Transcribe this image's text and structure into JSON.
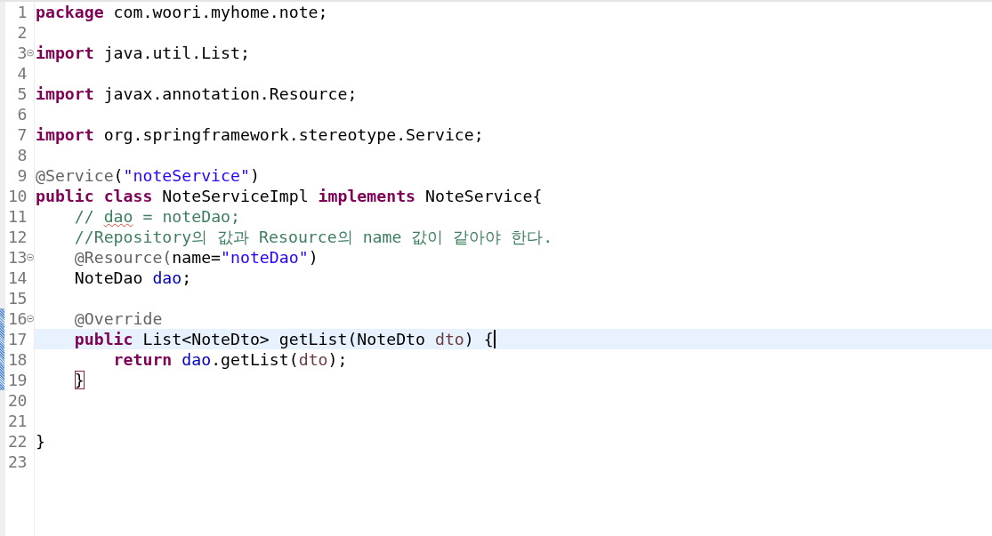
{
  "editor": {
    "lines": [
      {
        "number": "1",
        "current": false,
        "changed": false,
        "fold_marker": false,
        "caret": false,
        "tokens": [
          {
            "kind": "keyword",
            "text": "package"
          },
          {
            "kind": "plain",
            "text": " com.woori.myhome.note;"
          }
        ]
      },
      {
        "number": "2",
        "current": false,
        "changed": false,
        "fold_marker": false,
        "caret": false
      },
      {
        "number": "3",
        "current": false,
        "changed": false,
        "fold_marker": true,
        "caret": false,
        "tokens": [
          {
            "kind": "keyword",
            "text": "import"
          },
          {
            "kind": "plain",
            "text": " java.util.List;"
          }
        ]
      },
      {
        "number": "4",
        "current": false,
        "changed": false,
        "fold_marker": false,
        "caret": false
      },
      {
        "number": "5",
        "current": false,
        "changed": false,
        "fold_marker": false,
        "caret": false,
        "tokens": [
          {
            "kind": "keyword",
            "text": "import"
          },
          {
            "kind": "plain",
            "text": " javax.annotation.Resource;"
          }
        ]
      },
      {
        "number": "6",
        "current": false,
        "changed": false,
        "fold_marker": false,
        "caret": false
      },
      {
        "number": "7",
        "current": false,
        "changed": false,
        "fold_marker": false,
        "caret": false,
        "tokens": [
          {
            "kind": "keyword",
            "text": "import"
          },
          {
            "kind": "plain",
            "text": " org.springframework.stereotype.Service;"
          }
        ]
      },
      {
        "number": "8",
        "current": false,
        "changed": false,
        "fold_marker": false,
        "caret": false
      },
      {
        "number": "9",
        "current": false,
        "changed": false,
        "fold_marker": false,
        "caret": false,
        "tokens": [
          {
            "kind": "annotation",
            "text": "@Service"
          },
          {
            "kind": "plain",
            "text": "("
          },
          {
            "kind": "string",
            "text": "\"noteService\""
          },
          {
            "kind": "plain",
            "text": ")"
          }
        ]
      },
      {
        "number": "10",
        "current": false,
        "changed": false,
        "fold_marker": false,
        "caret": false,
        "tokens": [
          {
            "kind": "keyword",
            "text": "public class"
          },
          {
            "kind": "plain",
            "text": " NoteServiceImpl "
          },
          {
            "kind": "keyword",
            "text": "implements"
          },
          {
            "kind": "plain",
            "text": " NoteService{"
          }
        ]
      },
      {
        "number": "11",
        "current": false,
        "changed": false,
        "fold_marker": false,
        "caret": false,
        "tokens": [
          {
            "kind": "comment",
            "text": "    // "
          },
          {
            "kind": "misspelled",
            "text": "dao"
          },
          {
            "kind": "comment",
            "text": " = noteDao;"
          }
        ]
      },
      {
        "number": "12",
        "current": false,
        "changed": false,
        "fold_marker": false,
        "caret": false,
        "tokens": [
          {
            "kind": "comment",
            "text": "    //Repository의 값과 Resource의 name 값이 같아야 한다."
          }
        ]
      },
      {
        "number": "13",
        "current": false,
        "changed": false,
        "fold_marker": true,
        "caret": false,
        "tokens": [
          {
            "kind": "annotation",
            "text": "    @Resource("
          },
          {
            "kind": "plain",
            "text": "name="
          },
          {
            "kind": "string",
            "text": "\"noteDao\""
          },
          {
            "kind": "plain",
            "text": ")"
          }
        ]
      },
      {
        "number": "14",
        "current": false,
        "changed": false,
        "fold_marker": false,
        "caret": false,
        "tokens": [
          {
            "kind": "plain",
            "text": "    NoteDao "
          },
          {
            "kind": "field",
            "text": "dao"
          },
          {
            "kind": "plain",
            "text": ";"
          }
        ]
      },
      {
        "number": "15",
        "current": false,
        "changed": false,
        "fold_marker": false,
        "caret": false
      },
      {
        "number": "16",
        "current": false,
        "changed": true,
        "fold_marker": true,
        "caret": false,
        "tokens": [
          {
            "kind": "annotation",
            "text": "    @Override"
          }
        ]
      },
      {
        "number": "17",
        "current": true,
        "changed": true,
        "fold_marker": false,
        "caret": true,
        "tokens": [
          {
            "kind": "keyword",
            "text": "    public"
          },
          {
            "kind": "plain",
            "text": " List<NoteDto> getList(NoteDto "
          },
          {
            "kind": "param",
            "text": "dto"
          },
          {
            "kind": "plain",
            "text": ") {"
          }
        ]
      },
      {
        "number": "18",
        "current": false,
        "changed": true,
        "fold_marker": false,
        "caret": false,
        "tokens": [
          {
            "kind": "keyword",
            "text": "        return "
          },
          {
            "kind": "field",
            "text": "dao"
          },
          {
            "kind": "plain",
            "text": ".getList("
          },
          {
            "kind": "param",
            "text": "dto"
          },
          {
            "kind": "plain",
            "text": ");"
          }
        ]
      },
      {
        "number": "19",
        "current": false,
        "changed": true,
        "fold_marker": false,
        "caret": false,
        "tokens": [
          {
            "kind": "matched-bracket",
            "text": "    }"
          }
        ]
      },
      {
        "number": "20",
        "current": false,
        "changed": false,
        "fold_marker": false,
        "caret": false
      },
      {
        "number": "21",
        "current": false,
        "changed": false,
        "fold_marker": false,
        "caret": false
      },
      {
        "number": "22",
        "current": false,
        "changed": false,
        "fold_marker": false,
        "caret": false,
        "tokens": [
          {
            "kind": "plain",
            "text": "}"
          }
        ]
      },
      {
        "number": "23",
        "current": false,
        "changed": false,
        "fold_marker": false,
        "caret": false
      }
    ]
  }
}
